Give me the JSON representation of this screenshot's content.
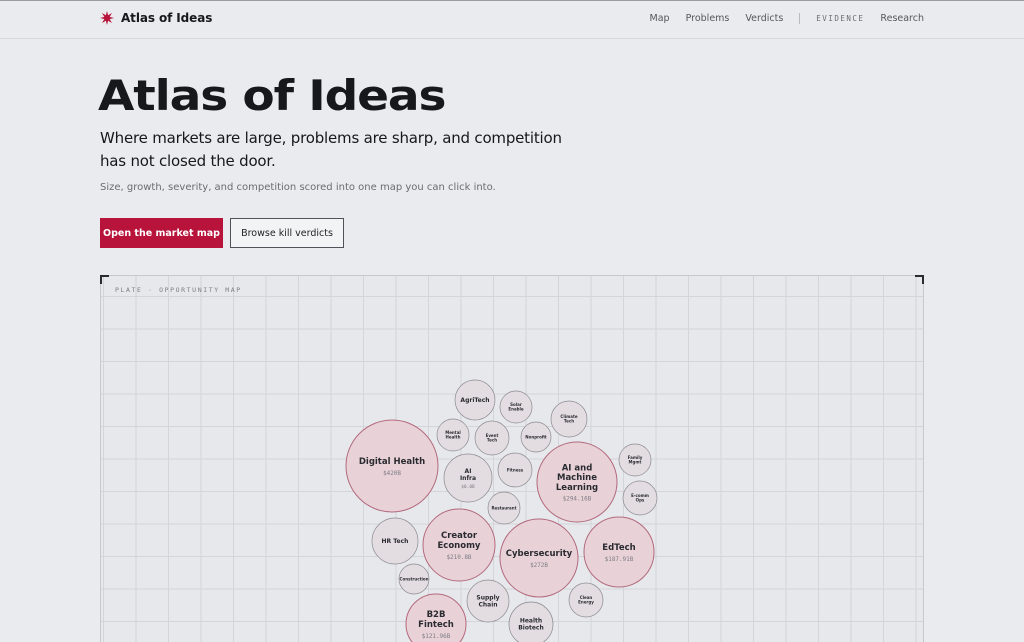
{
  "brand": {
    "name": "Atlas of Ideas",
    "accent": "#b8133a"
  },
  "nav": {
    "links": [
      "Map",
      "Problems",
      "Verdicts"
    ],
    "evidence_label": "EVIDENCE",
    "research_label": "Research"
  },
  "hero": {
    "title": "Atlas of Ideas",
    "subtitle": "Where markets are large, problems are sharp, and competition has not closed the door.",
    "description": "Size, growth, severity, and competition scored into one map you can click into.",
    "primary_cta": "Open the market map",
    "secondary_cta": "Browse kill verdicts"
  },
  "plate": {
    "label": "PLATE · OPPORTUNITY MAP",
    "bubbles": [
      {
        "name": "AgriTech",
        "size": ""
      },
      {
        "name": "Solar Enable",
        "size": ""
      },
      {
        "name": "Climate Tech",
        "size": ""
      },
      {
        "name": "Mental Health",
        "size": ""
      },
      {
        "name": "Event Tech",
        "size": ""
      },
      {
        "name": "Nonprofit",
        "size": ""
      },
      {
        "name": "Family Mgmt",
        "size": ""
      },
      {
        "name": "Digital Health",
        "size": "$420B"
      },
      {
        "name": "AI Infra",
        "size": "$0.0B"
      },
      {
        "name": "Fitness",
        "size": ""
      },
      {
        "name": "AI and Machine Learning",
        "size": "$294.16B"
      },
      {
        "name": "E-comm Ops",
        "size": ""
      },
      {
        "name": "Restaurant",
        "size": ""
      },
      {
        "name": "HR Tech",
        "size": ""
      },
      {
        "name": "Creator Economy",
        "size": "$210.8B"
      },
      {
        "name": "Cybersecurity",
        "size": "$272B"
      },
      {
        "name": "EdTech",
        "size": "$187.91B"
      },
      {
        "name": "Construction",
        "size": ""
      },
      {
        "name": "Supply Chain",
        "size": ""
      },
      {
        "name": "Clean Energy",
        "size": ""
      },
      {
        "name": "B2B Fintech",
        "size": "$121.96B"
      },
      {
        "name": "Health Biotech",
        "size": ""
      }
    ]
  }
}
